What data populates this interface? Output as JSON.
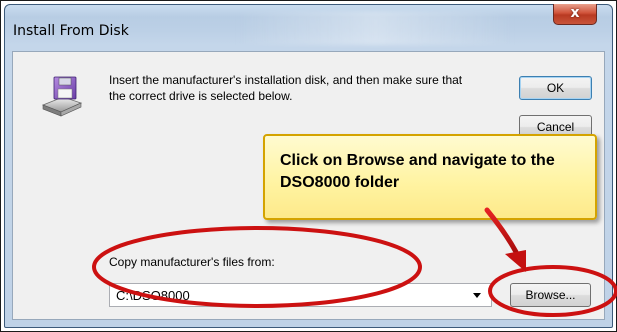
{
  "window": {
    "title": "Install From Disk",
    "close_label": "x"
  },
  "dialog": {
    "instructions": "Insert the manufacturer's installation disk, and then make sure that the correct drive is selected below.",
    "ok_label": "OK",
    "cancel_label": "Cancel",
    "copy_label": "Copy manufacturer's files from:",
    "path_value": "C:\\DSO8000",
    "browse_label": "Browse..."
  },
  "annotation": {
    "callout_text": "Click on Browse and navigate to the DSO8000 folder",
    "highlight_color": "#cc1111",
    "callout_color": "#fff3a0"
  },
  "icons": {
    "disk": "floppy-disk-drive-icon",
    "combo": "chevron-down-icon"
  }
}
